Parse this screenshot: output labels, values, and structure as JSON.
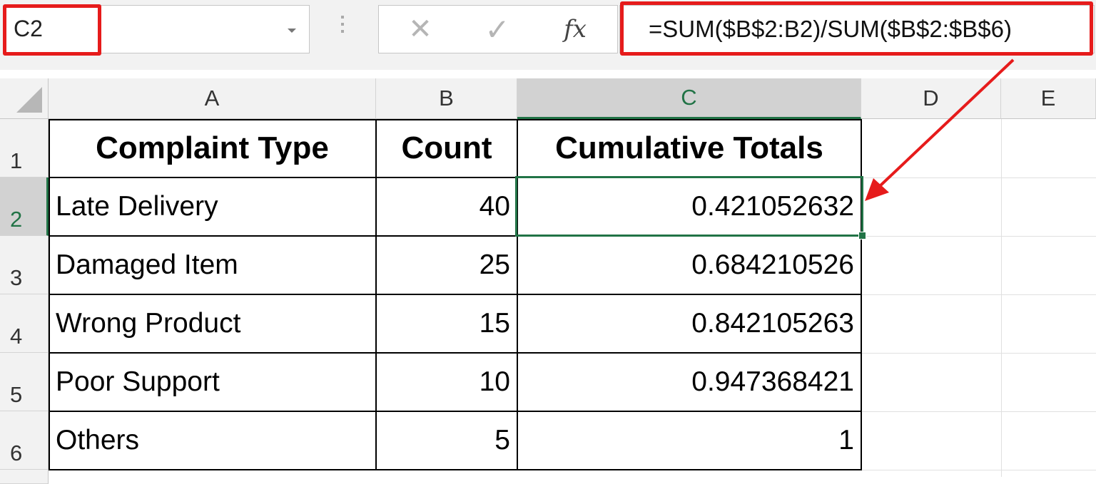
{
  "name_box": {
    "value": "C2"
  },
  "formula_bar": {
    "cancel_glyph": "✕",
    "enter_glyph": "✓",
    "fx_label": "fx",
    "formula": "=SUM($B$2:B2)/SUM($B$2:$B$6)"
  },
  "columns": [
    "A",
    "B",
    "C",
    "D",
    "E"
  ],
  "rows": [
    "1",
    "2",
    "3",
    "4",
    "5",
    "6"
  ],
  "header_row": {
    "a": "Complaint Type",
    "b": "Count",
    "c": "Cumulative Totals"
  },
  "table": [
    {
      "type": "Late Delivery",
      "count": "40",
      "cum": "0.421052632"
    },
    {
      "type": "Damaged Item",
      "count": "25",
      "cum": "0.684210526"
    },
    {
      "type": "Wrong Product",
      "count": "15",
      "cum": "0.842105263"
    },
    {
      "type": "Poor Support",
      "count": "10",
      "cum": "0.947368421"
    },
    {
      "type": "Others",
      "count": "5",
      "cum": "1"
    }
  ],
  "selection": {
    "cell": "C2",
    "column": "C",
    "row": "2"
  },
  "colors": {
    "accent_green": "#217346",
    "highlight_red": "#e61b1b"
  },
  "icons": {
    "cancel": "close-icon",
    "enter": "checkmark-icon",
    "function": "fx-icon",
    "dropdown": "chevron-down-icon"
  }
}
